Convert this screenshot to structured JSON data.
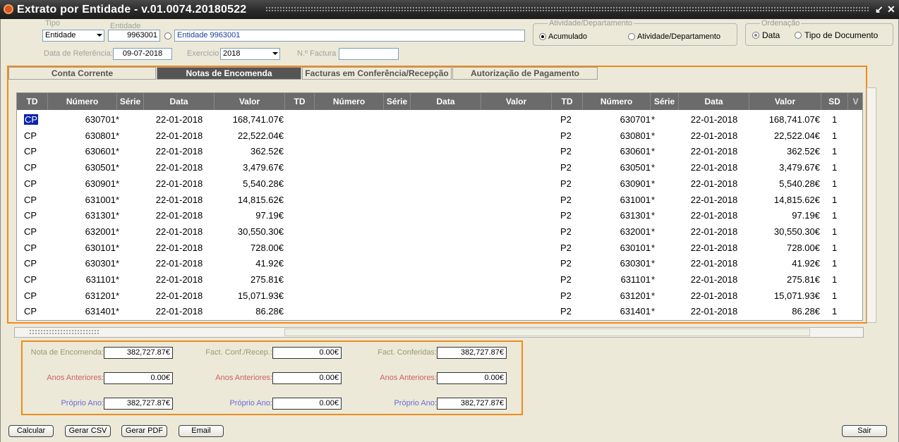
{
  "window": {
    "title": "Extrato por Entidade - v.01.0074.20180522",
    "minimize_glyph": "↙",
    "close_glyph": "✕"
  },
  "filters": {
    "tipo_label": "Tipo",
    "tipo_value": "Entidade",
    "entidade_label": "Entidade",
    "entidade_code": "9963001",
    "entidade_name": "Entidade 9963001",
    "data_ref_label": "Data de Referência:",
    "data_ref_value": "09-07-2018",
    "exercicio_label": "Exercício",
    "exercicio_value": "2018",
    "factura_label": "N.º Factura",
    "factura_value": ""
  },
  "atividade_group": {
    "title": "Atividade/Departamento",
    "options": [
      {
        "label": "Acumulado",
        "checked": true
      },
      {
        "label": "Atividade/Departamento",
        "checked": false
      }
    ]
  },
  "ordenacao_group": {
    "title": "Ordenação",
    "options": [
      {
        "label": "Data",
        "checked": true
      },
      {
        "label": "Tipo de Documento",
        "checked": false
      }
    ]
  },
  "tabs": [
    {
      "label": "Conta Corrente",
      "active": false
    },
    {
      "label": "Notas de Encomenda",
      "active": true
    },
    {
      "label": "Facturas em Conferência/Recepção",
      "active": false
    },
    {
      "label": "Autorização de Pagamento",
      "active": false
    }
  ],
  "grid": {
    "headers": [
      "TD",
      "Número",
      "Série",
      "Data",
      "Valor",
      "TD",
      "Número",
      "Série",
      "Data",
      "Valor",
      "TD",
      "Número",
      "Série",
      "Data",
      "Valor",
      "SD",
      "V"
    ],
    "rows": [
      {
        "td": "CP",
        "numero": "630701",
        "serie": "*",
        "data": "22-01-2018",
        "valor": "168,741.07€",
        "td2": "P2",
        "numero2": "630701",
        "serie2": "*",
        "data2": "22-01-2018",
        "valor2": "168,741.07€",
        "sd": "1"
      },
      {
        "td": "CP",
        "numero": "630801",
        "serie": "*",
        "data": "22-01-2018",
        "valor": "22,522.04€",
        "td2": "P2",
        "numero2": "630801",
        "serie2": "*",
        "data2": "22-01-2018",
        "valor2": "22,522.04€",
        "sd": "1"
      },
      {
        "td": "CP",
        "numero": "630601",
        "serie": "*",
        "data": "22-01-2018",
        "valor": "362.52€",
        "td2": "P2",
        "numero2": "630601",
        "serie2": "*",
        "data2": "22-01-2018",
        "valor2": "362.52€",
        "sd": "1"
      },
      {
        "td": "CP",
        "numero": "630501",
        "serie": "*",
        "data": "22-01-2018",
        "valor": "3,479.67€",
        "td2": "P2",
        "numero2": "630501",
        "serie2": "*",
        "data2": "22-01-2018",
        "valor2": "3,479.67€",
        "sd": "1"
      },
      {
        "td": "CP",
        "numero": "630901",
        "serie": "*",
        "data": "22-01-2018",
        "valor": "5,540.28€",
        "td2": "P2",
        "numero2": "630901",
        "serie2": "*",
        "data2": "22-01-2018",
        "valor2": "5,540.28€",
        "sd": "1"
      },
      {
        "td": "CP",
        "numero": "631001",
        "serie": "*",
        "data": "22-01-2018",
        "valor": "14,815.62€",
        "td2": "P2",
        "numero2": "631001",
        "serie2": "*",
        "data2": "22-01-2018",
        "valor2": "14,815.62€",
        "sd": "1"
      },
      {
        "td": "CP",
        "numero": "631301",
        "serie": "*",
        "data": "22-01-2018",
        "valor": "97.19€",
        "td2": "P2",
        "numero2": "631301",
        "serie2": "*",
        "data2": "22-01-2018",
        "valor2": "97.19€",
        "sd": "1"
      },
      {
        "td": "CP",
        "numero": "632001",
        "serie": "*",
        "data": "22-01-2018",
        "valor": "30,550.30€",
        "td2": "P2",
        "numero2": "632001",
        "serie2": "*",
        "data2": "22-01-2018",
        "valor2": "30,550.30€",
        "sd": "1"
      },
      {
        "td": "CP",
        "numero": "630101",
        "serie": "*",
        "data": "22-01-2018",
        "valor": "728.00€",
        "td2": "P2",
        "numero2": "630101",
        "serie2": "*",
        "data2": "22-01-2018",
        "valor2": "728.00€",
        "sd": "1"
      },
      {
        "td": "CP",
        "numero": "630301",
        "serie": "*",
        "data": "22-01-2018",
        "valor": "41.92€",
        "td2": "P2",
        "numero2": "630301",
        "serie2": "*",
        "data2": "22-01-2018",
        "valor2": "41.92€",
        "sd": "1"
      },
      {
        "td": "CP",
        "numero": "631101",
        "serie": "*",
        "data": "22-01-2018",
        "valor": "275.81€",
        "td2": "P2",
        "numero2": "631101",
        "serie2": "*",
        "data2": "22-01-2018",
        "valor2": "275.81€",
        "sd": "1"
      },
      {
        "td": "CP",
        "numero": "631201",
        "serie": "*",
        "data": "22-01-2018",
        "valor": "15,071.93€",
        "td2": "P2",
        "numero2": "631201",
        "serie2": "*",
        "data2": "22-01-2018",
        "valor2": "15,071.93€",
        "sd": "1"
      },
      {
        "td": "CP",
        "numero": "631401",
        "serie": "*",
        "data": "22-01-2018",
        "valor": "86.28€",
        "td2": "P2",
        "numero2": "631401",
        "serie2": "*",
        "data2": "22-01-2018",
        "valor2": "86.28€",
        "sd": "1"
      }
    ]
  },
  "totals": {
    "nota_encomenda_label": "Nota de Encomenda:",
    "nota_encomenda_value": "382,727.87€",
    "fact_conf_recep_label": "Fact. Conf./Recep.:",
    "fact_conf_recep_value": "0.00€",
    "fact_conferidas_label": "Fact. Conferidas:",
    "fact_conferidas_value": "382,727.87€",
    "anos_anteriores_label": "Anos Anteriores:",
    "anos_anteriores_1": "0.00€",
    "anos_anteriores_2": "0.00€",
    "anos_anteriores_3": "0.00€",
    "proprio_ano_label": "Próprio Ano:",
    "proprio_ano_1": "382,727.87€",
    "proprio_ano_2": "0.00€",
    "proprio_ano_3": "382,727.87€"
  },
  "buttons": {
    "calcular": "Calcular",
    "gerar_csv": "Gerar CSV",
    "gerar_pdf": "Gerar PDF",
    "email": "Email",
    "sair": "Sair"
  },
  "colors": {
    "highlight_frame": "#f28a1c",
    "grid_header": "#6b6b6b",
    "selection": "#0a24a8"
  }
}
